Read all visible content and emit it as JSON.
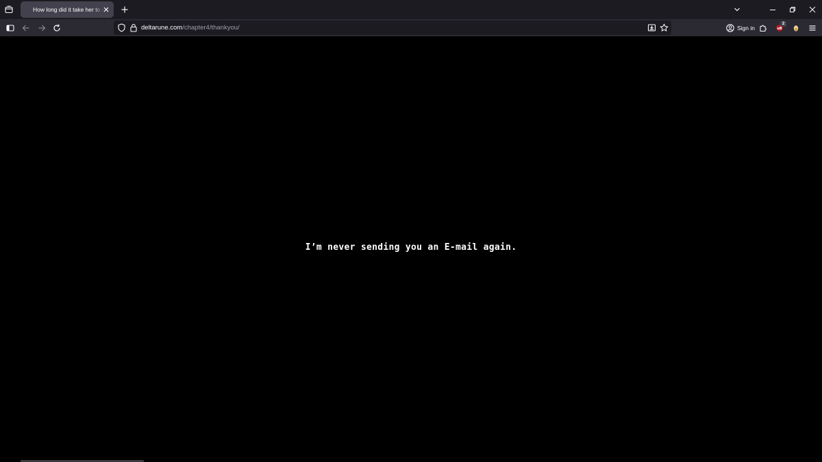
{
  "browser": {
    "tab": {
      "title": "How long did it take her to smile"
    },
    "url": {
      "host": "deltarune.com",
      "path": "/chapter4/thankyou/"
    },
    "account": {
      "sign_in_label": "Sign in"
    },
    "extensions": {
      "badge_count": "2"
    },
    "icons": {
      "tab_list": "tab-list-icon",
      "close_tab": "close-icon",
      "new_tab": "plus-icon",
      "tabs_dropdown": "chevron-down-icon",
      "minimize": "minimize-icon",
      "restore": "restore-icon",
      "close_window": "close-icon",
      "sidebar": "sidebar-icon",
      "back": "arrow-left-icon",
      "forward": "arrow-right-icon",
      "reload": "reload-icon",
      "tracking_protection": "shield-icon",
      "secure": "lock-icon",
      "reader_view": "reader-view-icon",
      "bookmark": "star-icon",
      "account": "account-icon",
      "extensions": "puzzle-icon",
      "extension_ublock": "ublock-icon",
      "extension_other": "extension-icon",
      "menu": "hamburger-menu-icon"
    },
    "colors": {
      "tabstrip": "#1c1b22",
      "active_tab": "#42414d",
      "navbar": "#2b2a33",
      "urlbar": "#1c1b22",
      "content_bg": "#000000",
      "ublock_red": "#b5161c"
    }
  },
  "page": {
    "message": "I’m never sending you an E-mail again."
  }
}
